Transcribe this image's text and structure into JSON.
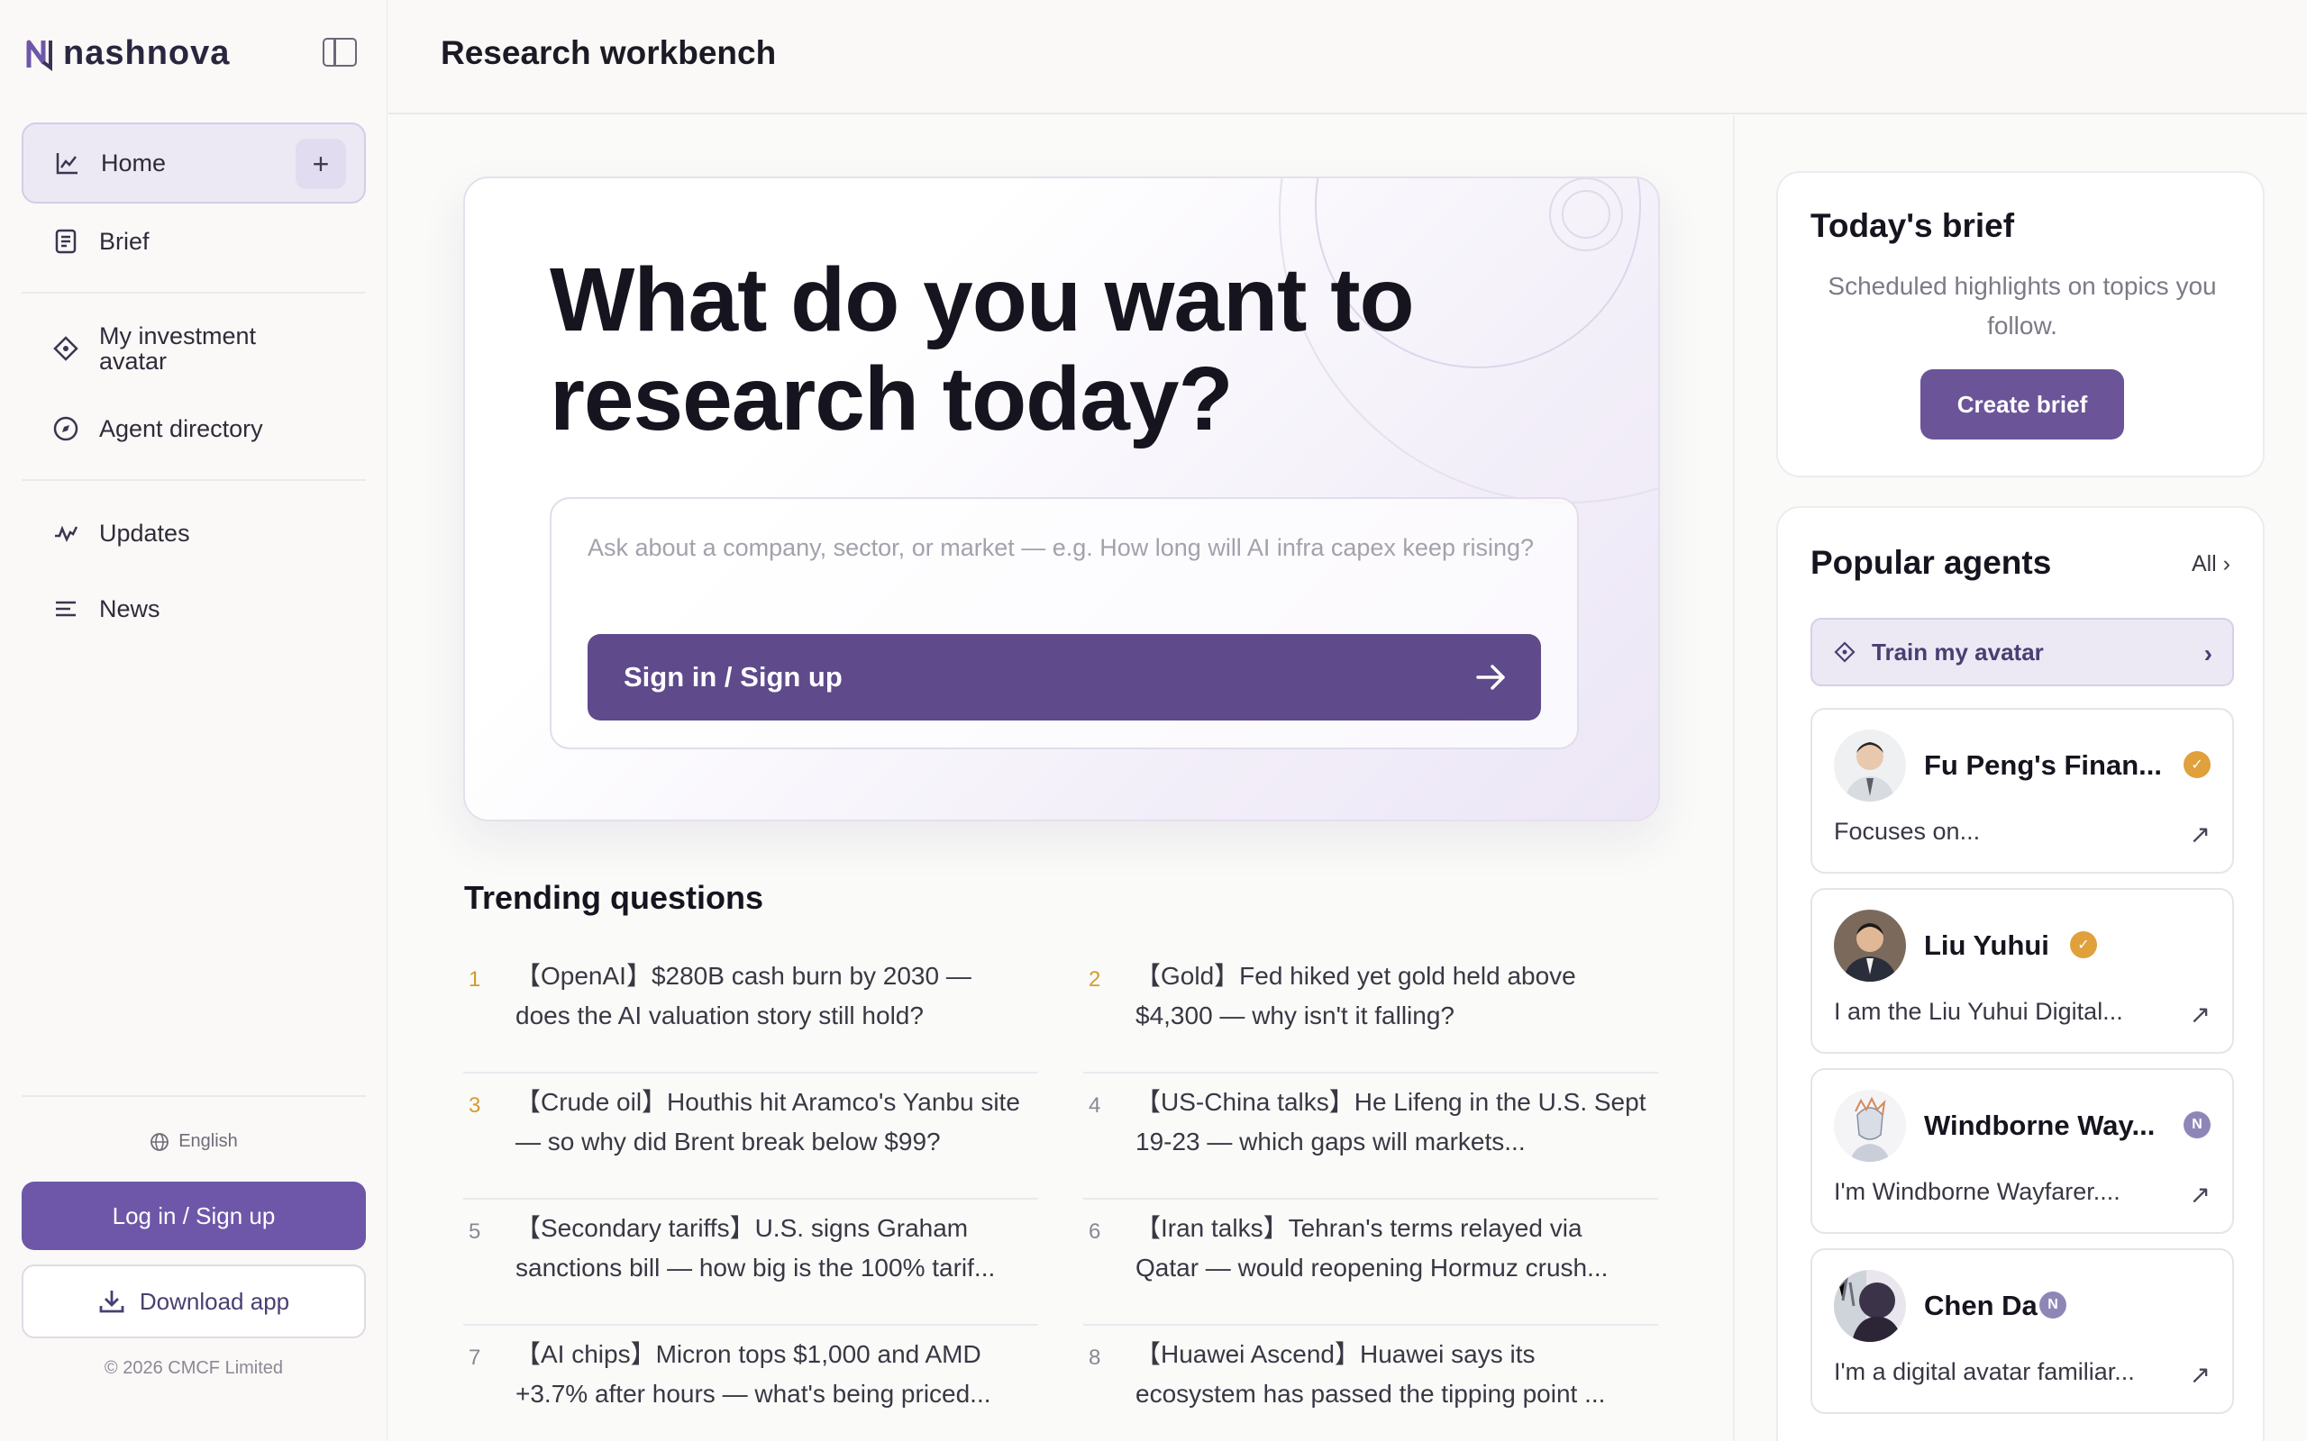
{
  "app": {
    "brand": "nashnova",
    "page_title": "Research workbench"
  },
  "sidebar": {
    "home_label": "Home",
    "items": [
      {
        "label": "Brief",
        "icon": "document-icon"
      },
      {
        "label": "My investment avatar",
        "icon": "diamond-icon"
      },
      {
        "label": "Agent directory",
        "icon": "compass-icon"
      },
      {
        "label": "Updates",
        "icon": "activity-icon"
      },
      {
        "label": "News",
        "icon": "list-icon"
      }
    ],
    "language": "English",
    "login_label": "Log in / Sign up",
    "download_label": "Download app",
    "copyright": "© 2026 CMCF Limited"
  },
  "hero": {
    "title": "What do you want to research today?",
    "placeholder": "Ask about a company, sector, or market — e.g. How long will AI infra capex keep rising?",
    "cta": "Sign in / Sign up"
  },
  "trending": {
    "title": "Trending questions",
    "items": [
      {
        "rank": "1",
        "text": "【OpenAI】$280B cash burn by 2030 — does the AI valuation story still hold?"
      },
      {
        "rank": "2",
        "text": "【Gold】Fed hiked yet gold held above $4,300 — why isn't it falling?"
      },
      {
        "rank": "3",
        "text": "【Crude oil】Houthis hit Aramco's Yanbu site — so why did Brent break below $99?"
      },
      {
        "rank": "4",
        "text": "【US-China talks】He Lifeng in the U.S. Sept 19-23 — which gaps will markets..."
      },
      {
        "rank": "5",
        "text": "【Secondary tariffs】U.S. signs Graham sanctions bill — how big is the 100% tarif..."
      },
      {
        "rank": "6",
        "text": "【Iran talks】Tehran's terms relayed via Qatar — would reopening Hormuz crush..."
      },
      {
        "rank": "7",
        "text": "【AI chips】Micron tops $1,000 and AMD +3.7% after hours — what's being priced..."
      },
      {
        "rank": "8",
        "text": "【Huawei Ascend】Huawei says its ecosystem has passed the tipping point ..."
      }
    ]
  },
  "brief": {
    "title": "Today's brief",
    "subtitle": "Scheduled highlights on topics you follow.",
    "button": "Create brief"
  },
  "agents": {
    "title": "Popular agents",
    "all_label": "All ›",
    "train_label": "Train my avatar",
    "list": [
      {
        "name": "Fu Peng's Finan...",
        "desc": "Focuses on...",
        "badge": "gold"
      },
      {
        "name": "Liu Yuhui",
        "desc": "I am the Liu Yuhui Digital...",
        "badge": "gold"
      },
      {
        "name": "Windborne Way...",
        "desc": "I'm Windborne Wayfarer....",
        "badge": "purple"
      },
      {
        "name": "Chen Da",
        "desc": "I'm a digital avatar familiar...",
        "badge": "purple"
      }
    ]
  },
  "colors": {
    "accent": "#5f4a8b",
    "accent_light": "#6e57a8",
    "rank_hot": "#d69a2d",
    "verified_gold": "#e0a03c"
  }
}
